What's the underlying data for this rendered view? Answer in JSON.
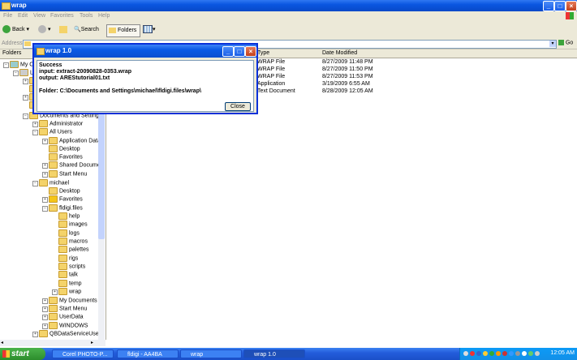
{
  "window": {
    "title": "wrap"
  },
  "menu": [
    "File",
    "Edit",
    "View",
    "Favorites",
    "Tools",
    "Help"
  ],
  "toolbar": {
    "back": "Back",
    "search": "Search",
    "folders": "Folders"
  },
  "address": {
    "label": "Address",
    "go": "Go"
  },
  "folders_pane": {
    "header": "Folders",
    "items": [
      {
        "label": "My C"
      },
      {
        "label": "L"
      },
      {
        "label": "Documents and Setting"
      },
      {
        "label": "Administrator"
      },
      {
        "label": "All Users"
      },
      {
        "label": "Application Data"
      },
      {
        "label": "Desktop"
      },
      {
        "label": "Favorites"
      },
      {
        "label": "Shared Docume"
      },
      {
        "label": "Start Menu"
      },
      {
        "label": "michael"
      },
      {
        "label": "Desktop"
      },
      {
        "label": "Favorites"
      },
      {
        "label": "fldigi.files"
      },
      {
        "label": "help"
      },
      {
        "label": "images"
      },
      {
        "label": "logs"
      },
      {
        "label": "macros"
      },
      {
        "label": "palettes"
      },
      {
        "label": "rigs"
      },
      {
        "label": "scripts"
      },
      {
        "label": "talk"
      },
      {
        "label": "temp"
      },
      {
        "label": "wrap"
      },
      {
        "label": "My Documents"
      },
      {
        "label": "Start Menu"
      },
      {
        "label": "UserData"
      },
      {
        "label": "WINDOWS"
      },
      {
        "label": "QBDataServiceUser:"
      }
    ]
  },
  "filelist": {
    "columns": [
      "Type",
      "Date Modified"
    ],
    "rows": [
      {
        "type": "WRAP File",
        "date": "8/27/2009 11:48 PM"
      },
      {
        "type": "WRAP File",
        "date": "8/27/2009 11:50 PM"
      },
      {
        "type": "WRAP File",
        "date": "8/27/2009 11:53 PM"
      },
      {
        "type": "Application",
        "date": "3/19/2009 6:55 AM"
      },
      {
        "type": "Text Document",
        "date": "8/28/2009 12:05 AM"
      }
    ]
  },
  "dialog": {
    "title": "wrap 1.0",
    "lines": [
      "Success",
      "input: extract-20090828-0353.wrap",
      "output: AREStutorial01.txt",
      "",
      "Folder: C:\\Documents and Settings\\michael\\fldigi.files\\wrap\\"
    ],
    "close": "Close"
  },
  "taskbar": {
    "start": "start",
    "tasks": [
      "Corel PHOTO-P...",
      "fldigi - AA4BA",
      "wrap",
      "wrap 1.0"
    ],
    "clock": "12:05 AM"
  }
}
